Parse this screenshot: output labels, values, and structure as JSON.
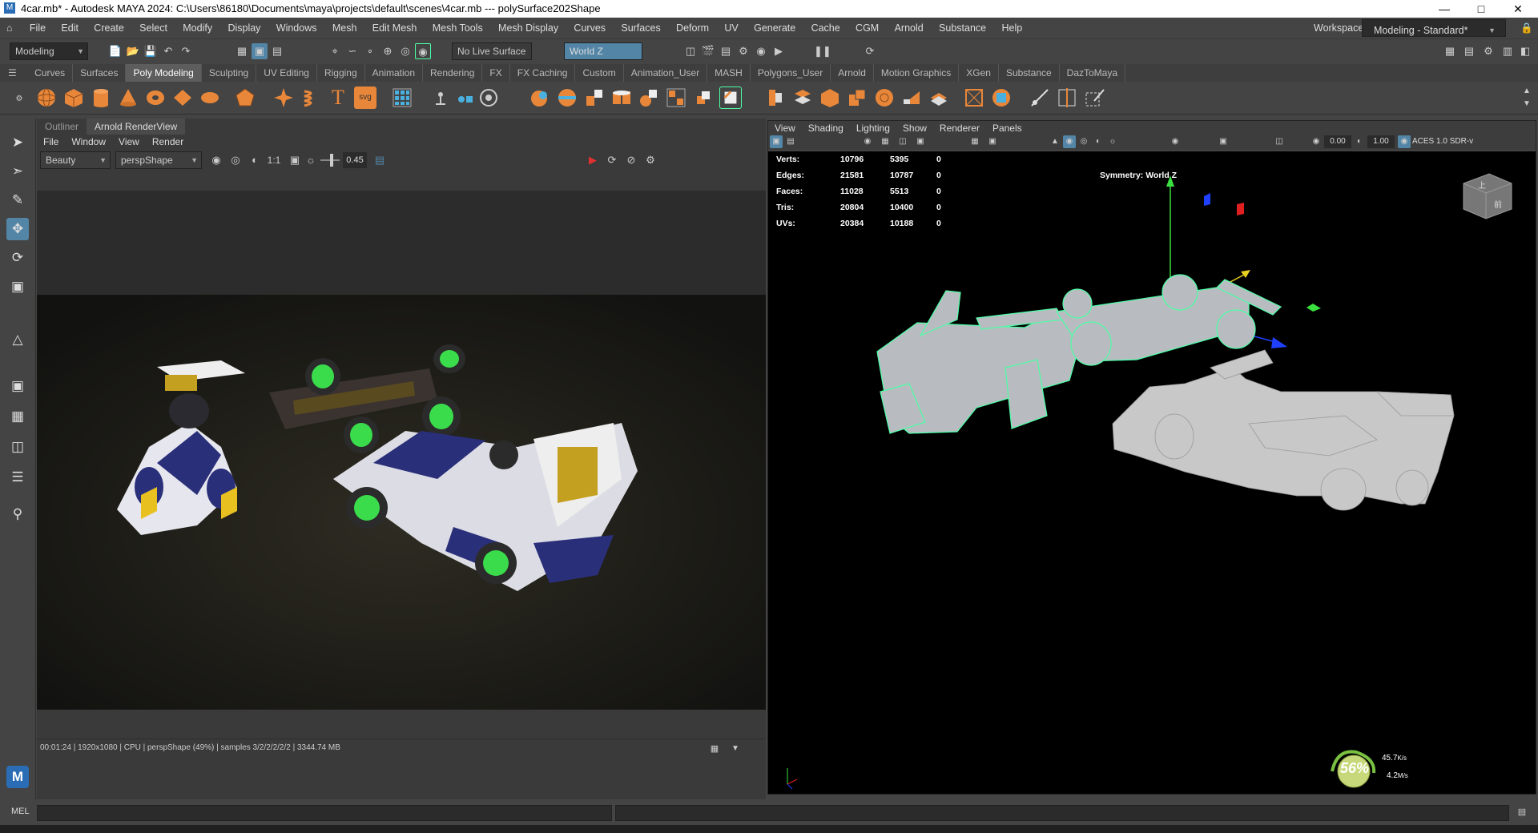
{
  "window": {
    "title": "4car.mb* - Autodesk MAYA 2024: C:\\Users\\86180\\Documents\\maya\\projects\\default\\scenes\\4car.mb   ---   polySurface202Shape",
    "app_icon": "M"
  },
  "menubar": {
    "items": [
      "File",
      "Edit",
      "Create",
      "Select",
      "Modify",
      "Display",
      "Windows",
      "Mesh",
      "Edit Mesh",
      "Mesh Tools",
      "Mesh Display",
      "Curves",
      "Surfaces",
      "Deform",
      "UV",
      "Generate",
      "Cache",
      "CGM",
      "Arnold",
      "Substance",
      "Help"
    ],
    "workspace_label": "Workspace:",
    "workspace_value": "Modeling - Standard*"
  },
  "status_line": {
    "mode_menu": "Modeling",
    "live_surface": "No Live Surface",
    "symmetry": "World Z"
  },
  "shelf": {
    "tabs": [
      "Curves",
      "Surfaces",
      "Poly Modeling",
      "Sculpting",
      "UV Editing",
      "Rigging",
      "Animation",
      "Rendering",
      "FX",
      "FX Caching",
      "Custom",
      "Animation_User",
      "MASH",
      "Polygons_User",
      "Arnold",
      "Motion Graphics",
      "XGen",
      "Substance",
      "DazToMaya"
    ],
    "active_tab": "Poly Modeling",
    "icons": [
      "sphere-icon",
      "cube-icon",
      "cylinder-icon",
      "cone-icon",
      "torus-icon",
      "plane-icon",
      "disk-icon",
      "platonic-icon",
      "super-shape-icon",
      "helix-icon",
      "type-icon",
      "svg-icon",
      "combine-icon",
      "separate-icon",
      "smooth-icon",
      "extrude-icon",
      "bridge-icon",
      "bevel-icon",
      "fill-hole-icon",
      "append-icon",
      "multi-cut-icon",
      "target-weld-icon",
      "connect-icon"
    ],
    "svg_label": "svg",
    "type_label": "T"
  },
  "left_panel": {
    "tabs": [
      "Outliner",
      "Arnold RenderView"
    ],
    "active_tab": "Arnold RenderView",
    "menu": [
      "File",
      "Window",
      "View",
      "Render"
    ],
    "aov": "Beauty",
    "camera": "perspShape",
    "ratio": "1:1",
    "exposure": "0.45",
    "status": "00:01:24  |  1920x1080  |  CPU  |  perspShape (49%)  |  samples 3/2/2/2/2/2  |  3344.74 MB"
  },
  "viewport": {
    "menu": [
      "View",
      "Shading",
      "Lighting",
      "Show",
      "Renderer",
      "Panels"
    ],
    "gamma": "0.00",
    "exposure": "1.00",
    "color_space": "ACES 1.0 SDR-v",
    "symmetry_label": "Symmetry: World Z",
    "stats": [
      {
        "label": "Verts:",
        "a": "10796",
        "b": "5395",
        "c": "0"
      },
      {
        "label": "Edges:",
        "a": "21581",
        "b": "10787",
        "c": "0"
      },
      {
        "label": "Faces:",
        "a": "11028",
        "b": "5513",
        "c": "0"
      },
      {
        "label": "Tris:",
        "a": "20804",
        "b": "10400",
        "c": "0"
      },
      {
        "label": "UVs:",
        "a": "20384",
        "b": "10188",
        "c": "0"
      }
    ],
    "widget_percent": "56%",
    "widget_up": "45.7",
    "widget_up_unit": "K/s",
    "widget_down": "4.2",
    "widget_down_unit": "M/s",
    "viewcube_top": "上",
    "viewcube_front": "前"
  },
  "cmd": {
    "label": "MEL"
  },
  "colors": {
    "accent": "#5285a6",
    "selection": "#4cffa6",
    "viewport_bg": "#000000"
  }
}
